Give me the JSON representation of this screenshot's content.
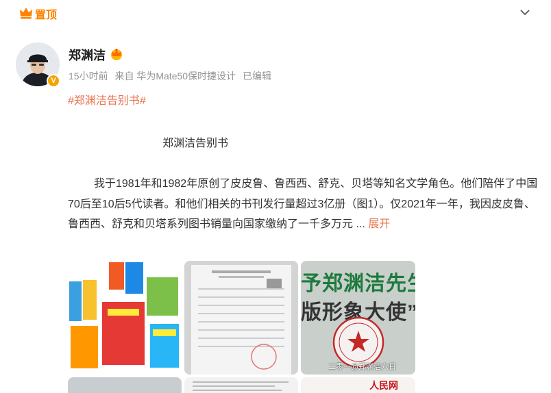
{
  "pin": {
    "label": "置顶"
  },
  "post": {
    "username": "郑渊洁",
    "meta": {
      "time": "15小时前",
      "source": "来自 华为Mate50保时捷设计",
      "edited": "已编辑"
    },
    "hashtag": "#郑渊洁告别书#",
    "title": "郑渊洁告别书",
    "body": "我于1981年和1982年原创了皮皮鲁、鲁西西、舒克、贝塔等知名文学角色。他们陪伴了中国70后至10后5代读者。和他们相关的书刊发行量超过3亿册（图1）。仅2021年一年，我因皮皮鲁、鲁西西、舒克和贝塔系列图书销量向国家缴纳了一千多万元 ...",
    "expand_label": "展开"
  },
  "images": {
    "sign_line1": "予郑渊洁先生",
    "sign_line2": "版形象大使”",
    "watermark": "二零一@郑渊洁六日",
    "renmin": "人民网"
  },
  "colors": {
    "accent": "#ff8200",
    "link": "#eb7350",
    "meta": "#939393"
  },
  "icons": {
    "pin": "crown-icon",
    "collapse": "chevron-down-icon",
    "verified": "verified-badge-icon",
    "vip": "vip-crown-icon"
  }
}
